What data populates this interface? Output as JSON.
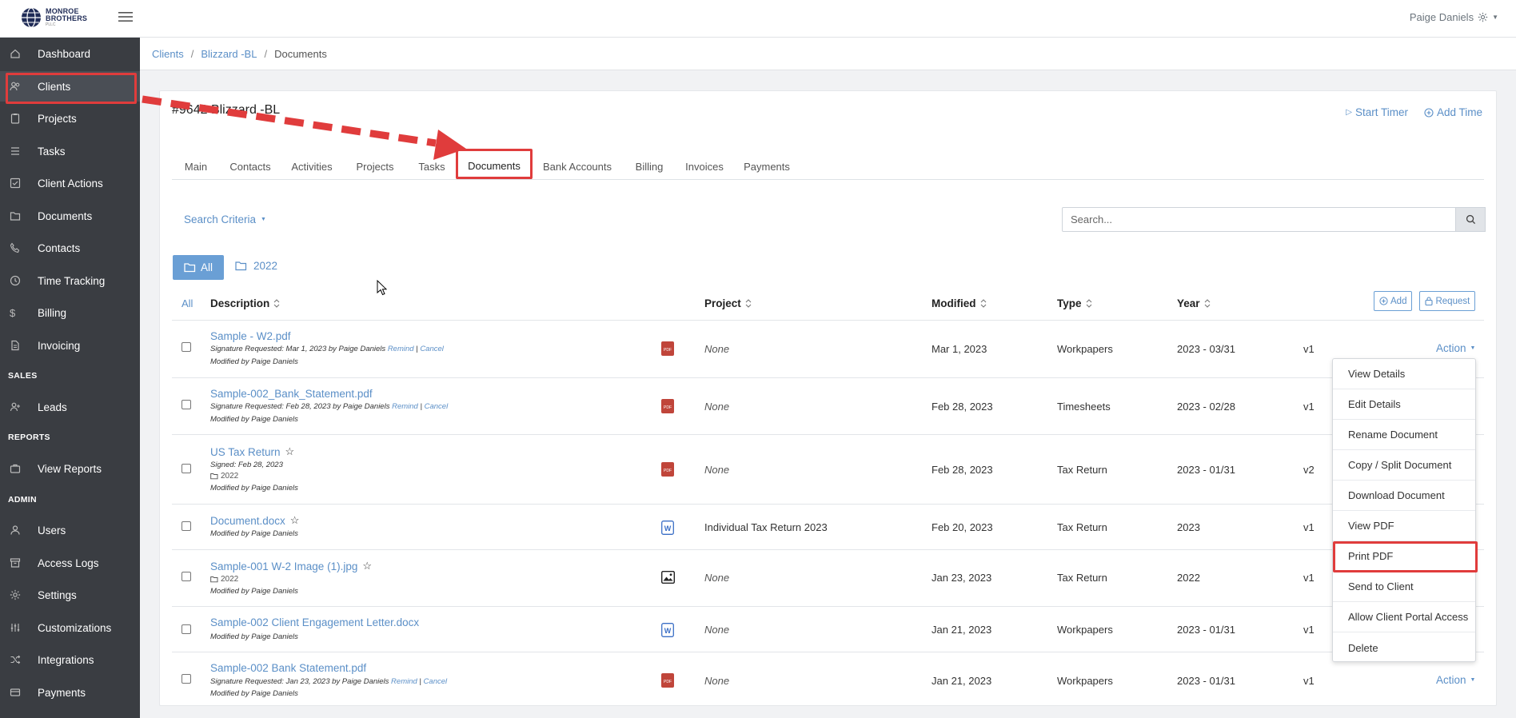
{
  "brand": {
    "line1": "MONROE",
    "line2": "BROTHERS",
    "line3": "PLLC"
  },
  "user": {
    "name": "Paige Daniels"
  },
  "colors": {
    "accent": "#5b8fc7",
    "sidebar": "#3a3d42",
    "highlight": "#e03c3c",
    "primary_button": "#6a9fd5"
  },
  "sidebar": {
    "items": [
      {
        "label": "Dashboard",
        "icon": "dashboard-icon"
      },
      {
        "label": "Clients",
        "icon": "users-icon"
      },
      {
        "label": "Projects",
        "icon": "clipboard-icon"
      },
      {
        "label": "Tasks",
        "icon": "list-icon"
      },
      {
        "label": "Client Actions",
        "icon": "checkbox-icon"
      },
      {
        "label": "Documents",
        "icon": "folder-icon"
      },
      {
        "label": "Contacts",
        "icon": "phone-icon"
      },
      {
        "label": "Time Tracking",
        "icon": "clock-icon"
      },
      {
        "label": "Billing",
        "icon": "dollar-icon"
      },
      {
        "label": "Invoicing",
        "icon": "file-icon"
      }
    ],
    "sales_label": "SALES",
    "sales_items": [
      {
        "label": "Leads",
        "icon": "user-plus-icon"
      }
    ],
    "reports_label": "REPORTS",
    "reports_items": [
      {
        "label": "View Reports",
        "icon": "briefcase-icon"
      }
    ],
    "admin_label": "ADMIN",
    "admin_items": [
      {
        "label": "Users",
        "icon": "user-icon"
      },
      {
        "label": "Access Logs",
        "icon": "archive-icon"
      },
      {
        "label": "Settings",
        "icon": "gear-icon"
      },
      {
        "label": "Customizations",
        "icon": "sliders-icon"
      },
      {
        "label": "Integrations",
        "icon": "shuffle-icon"
      },
      {
        "label": "Payments",
        "icon": "credit-card-icon"
      }
    ]
  },
  "breadcrumb": {
    "items": [
      "Clients",
      "Blizzard -BL"
    ],
    "current": "Documents"
  },
  "client": {
    "title": "#9642 Blizzard -BL"
  },
  "top_actions": {
    "start_timer": "Start Timer",
    "add_time": "Add Time"
  },
  "tabs": [
    "Main",
    "Contacts",
    "Activities",
    "Projects",
    "Tasks",
    "Documents",
    "Bank Accounts",
    "Billing",
    "Invoices",
    "Payments"
  ],
  "search": {
    "criteria_label": "Search Criteria",
    "placeholder": "Search..."
  },
  "folders": {
    "all": "All",
    "year": "2022"
  },
  "table": {
    "select_all": "All",
    "headers": {
      "description": "Description",
      "project": "Project",
      "modified": "Modified",
      "type": "Type",
      "year": "Year"
    },
    "add_label": "Add",
    "request_label": "Request",
    "rows": [
      {
        "name": "Sample - W2.pdf",
        "meta1": "Signature Requested: Mar 1, 2023 by Paige Daniels",
        "remind": "Remind",
        "cancel": "Cancel",
        "modified_by": "Modified by Paige Daniels",
        "project": "None",
        "modified": "Mar 1, 2023",
        "type": "Workpapers",
        "year": "2023 - 03/31",
        "version": "v1",
        "action": "Action"
      },
      {
        "name": "Sample-002_Bank_Statement.pdf",
        "meta1": "Signature Requested: Feb 28, 2023 by Paige Daniels",
        "remind": "Remind",
        "cancel": "Cancel",
        "modified_by": "Modified by Paige Daniels",
        "project": "None",
        "modified": "Feb 28, 2023",
        "type": "Timesheets",
        "year": "2023 - 02/28",
        "version": "v1"
      },
      {
        "name": "US Tax Return",
        "meta1": "Signed: Feb 28, 2023",
        "folder": "2022",
        "modified_by": "Modified by Paige Daniels",
        "project": "None",
        "modified": "Feb 28, 2023",
        "type": "Tax Return",
        "year": "2023 - 01/31",
        "version": "v2"
      },
      {
        "name": "Document.docx",
        "modified_by": "Modified by Paige Daniels",
        "project": "Individual Tax Return 2023",
        "modified": "Feb 20, 2023",
        "type": "Tax Return",
        "year": "2023",
        "version": "v1"
      },
      {
        "name": "Sample-001 W-2 Image (1).jpg",
        "folder": "2022",
        "modified_by": "Modified by Paige Daniels",
        "project": "None",
        "modified": "Jan 23, 2023",
        "type": "Tax Return",
        "year": "2022",
        "version": "v1"
      },
      {
        "name": "Sample-002 Client Engagement Letter.docx",
        "modified_by": "Modified by Paige Daniels",
        "project": "None",
        "modified": "Jan 21, 2023",
        "type": "Workpapers",
        "year": "2023 - 01/31",
        "version": "v1"
      },
      {
        "name": "Sample-002 Bank Statement.pdf",
        "meta1": "Signature Requested: Jan 23, 2023 by Paige Daniels",
        "remind": "Remind",
        "cancel": "Cancel",
        "modified_by": "Modified by Paige Daniels",
        "project": "None",
        "modified": "Jan 21, 2023",
        "type": "Workpapers",
        "year": "2023 - 01/31",
        "version": "v1",
        "action": "Action"
      }
    ]
  },
  "dropdown": [
    "View Details",
    "Edit Details",
    "Rename Document",
    "Copy / Split Document",
    "Download Document",
    "View PDF",
    "Print PDF",
    "Send to Client",
    "Allow Client Portal Access",
    "Delete"
  ]
}
